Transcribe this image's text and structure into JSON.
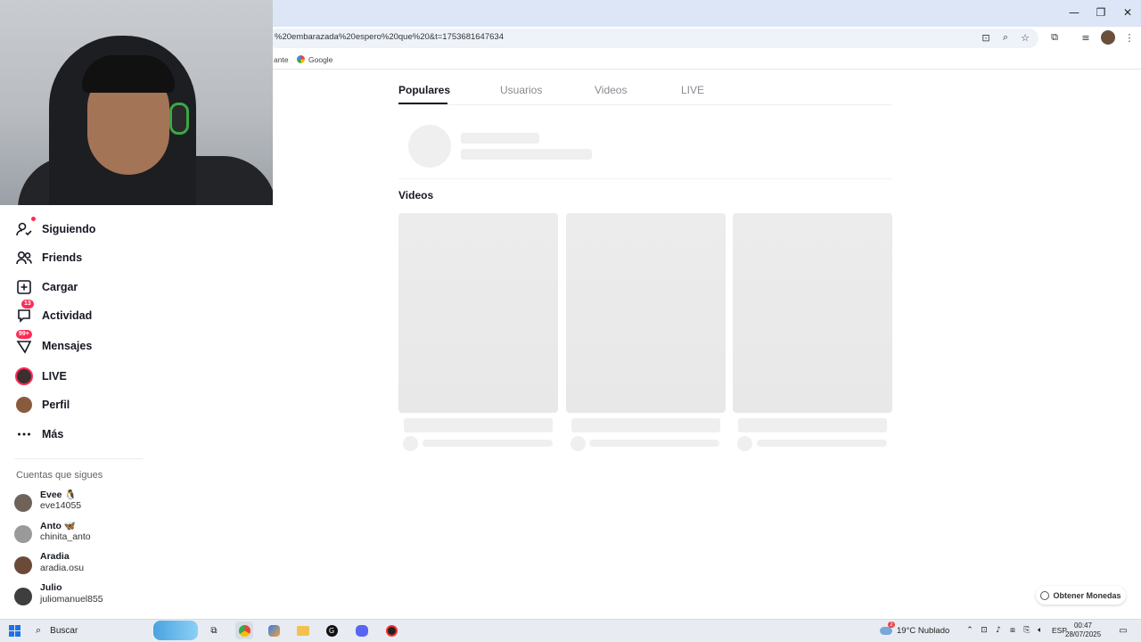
{
  "browser": {
    "url": "%20embarazada%20espero%20que%20&t=1753681647634",
    "bookmarks": [
      "ante",
      "Google"
    ],
    "window_controls": {
      "minimize": "—",
      "restore": "❐",
      "close": "✕"
    }
  },
  "sidebar": {
    "items": [
      {
        "label": "Siguiendo",
        "icon": "following-icon",
        "badge": ""
      },
      {
        "label": "Friends",
        "icon": "friends-icon",
        "badge": ""
      },
      {
        "label": "Cargar",
        "icon": "upload-icon",
        "badge": ""
      },
      {
        "label": "Actividad",
        "icon": "activity-icon",
        "badge": "13"
      },
      {
        "label": "Mensajes",
        "icon": "messages-icon",
        "badge": "99+"
      },
      {
        "label": "LIVE",
        "icon": "live-icon",
        "badge": ""
      },
      {
        "label": "Perfil",
        "icon": "profile-icon",
        "badge": ""
      },
      {
        "label": "Más",
        "icon": "more-icon",
        "badge": ""
      }
    ],
    "following_heading": "Cuentas que sigues",
    "accounts": [
      {
        "name": "Evee 🐧",
        "username": "eve14055"
      },
      {
        "name": "Anto 🦋",
        "username": "chinita_anto"
      },
      {
        "name": "Aradia",
        "username": "aradia.osu"
      },
      {
        "name": "Julio",
        "username": "juliomanuel855"
      }
    ]
  },
  "main": {
    "tabs": [
      "Populares",
      "Usuarios",
      "Videos",
      "LIVE"
    ],
    "active_tab": "Populares",
    "section_title": "Videos",
    "coins_button": "Obtener Monedas"
  },
  "taskbar": {
    "search_label": "Buscar",
    "weather": "19°C  Nublado",
    "weather_badge": "2",
    "language": "ESP",
    "time": "00:47",
    "date": "28/07/2025"
  },
  "colors": {
    "accent": "#fe2c55",
    "text": "#161823",
    "muted": "#8a8b91",
    "skeleton": "#efefef"
  }
}
